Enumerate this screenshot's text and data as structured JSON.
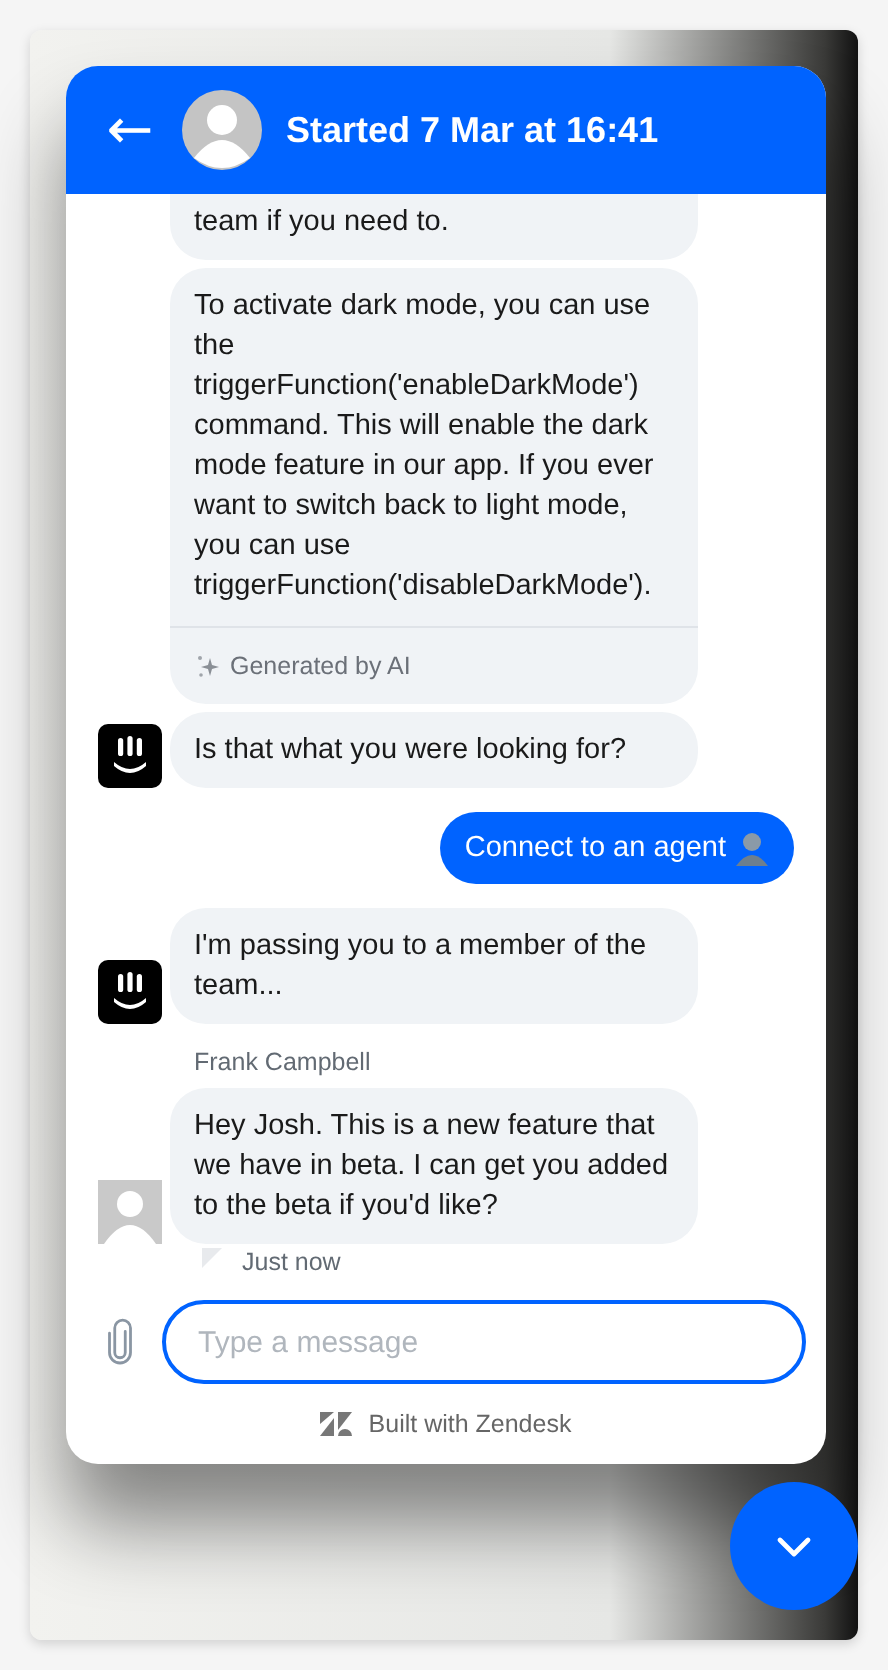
{
  "header": {
    "back": "←",
    "title": "Started 7 Mar at 16:41"
  },
  "messages": [
    {
      "kind": "bot",
      "text": "team if you need to."
    },
    {
      "kind": "bot",
      "text": "To activate dark mode, you can use the triggerFunction('enableDarkMode') command. This will enable the dark mode feature in our app. If you ever want to switch back to light mode, you can use triggerFunction('disableDarkMode').",
      "footer": "Generated by AI"
    },
    {
      "kind": "bot",
      "avatar": {
        "kind": "bot"
      },
      "text": "Is that what you were looking for?"
    },
    {
      "kind": "user",
      "text": "Connect to an agent"
    },
    {
      "kind": "bot",
      "avatar": {
        "kind": "bot"
      },
      "text": "I'm passing you to a member of the team..."
    },
    {
      "kind": "agent",
      "avatar": {
        "kind": "person"
      },
      "sender": "Frank Campbell",
      "text": "Hey Josh. This is a new feature that we have in beta. I can get you added to the beta if you'd like?",
      "time": "Just now"
    }
  ],
  "composer": {
    "placeholder": "Type a message"
  },
  "branding": "Built with Zendesk"
}
